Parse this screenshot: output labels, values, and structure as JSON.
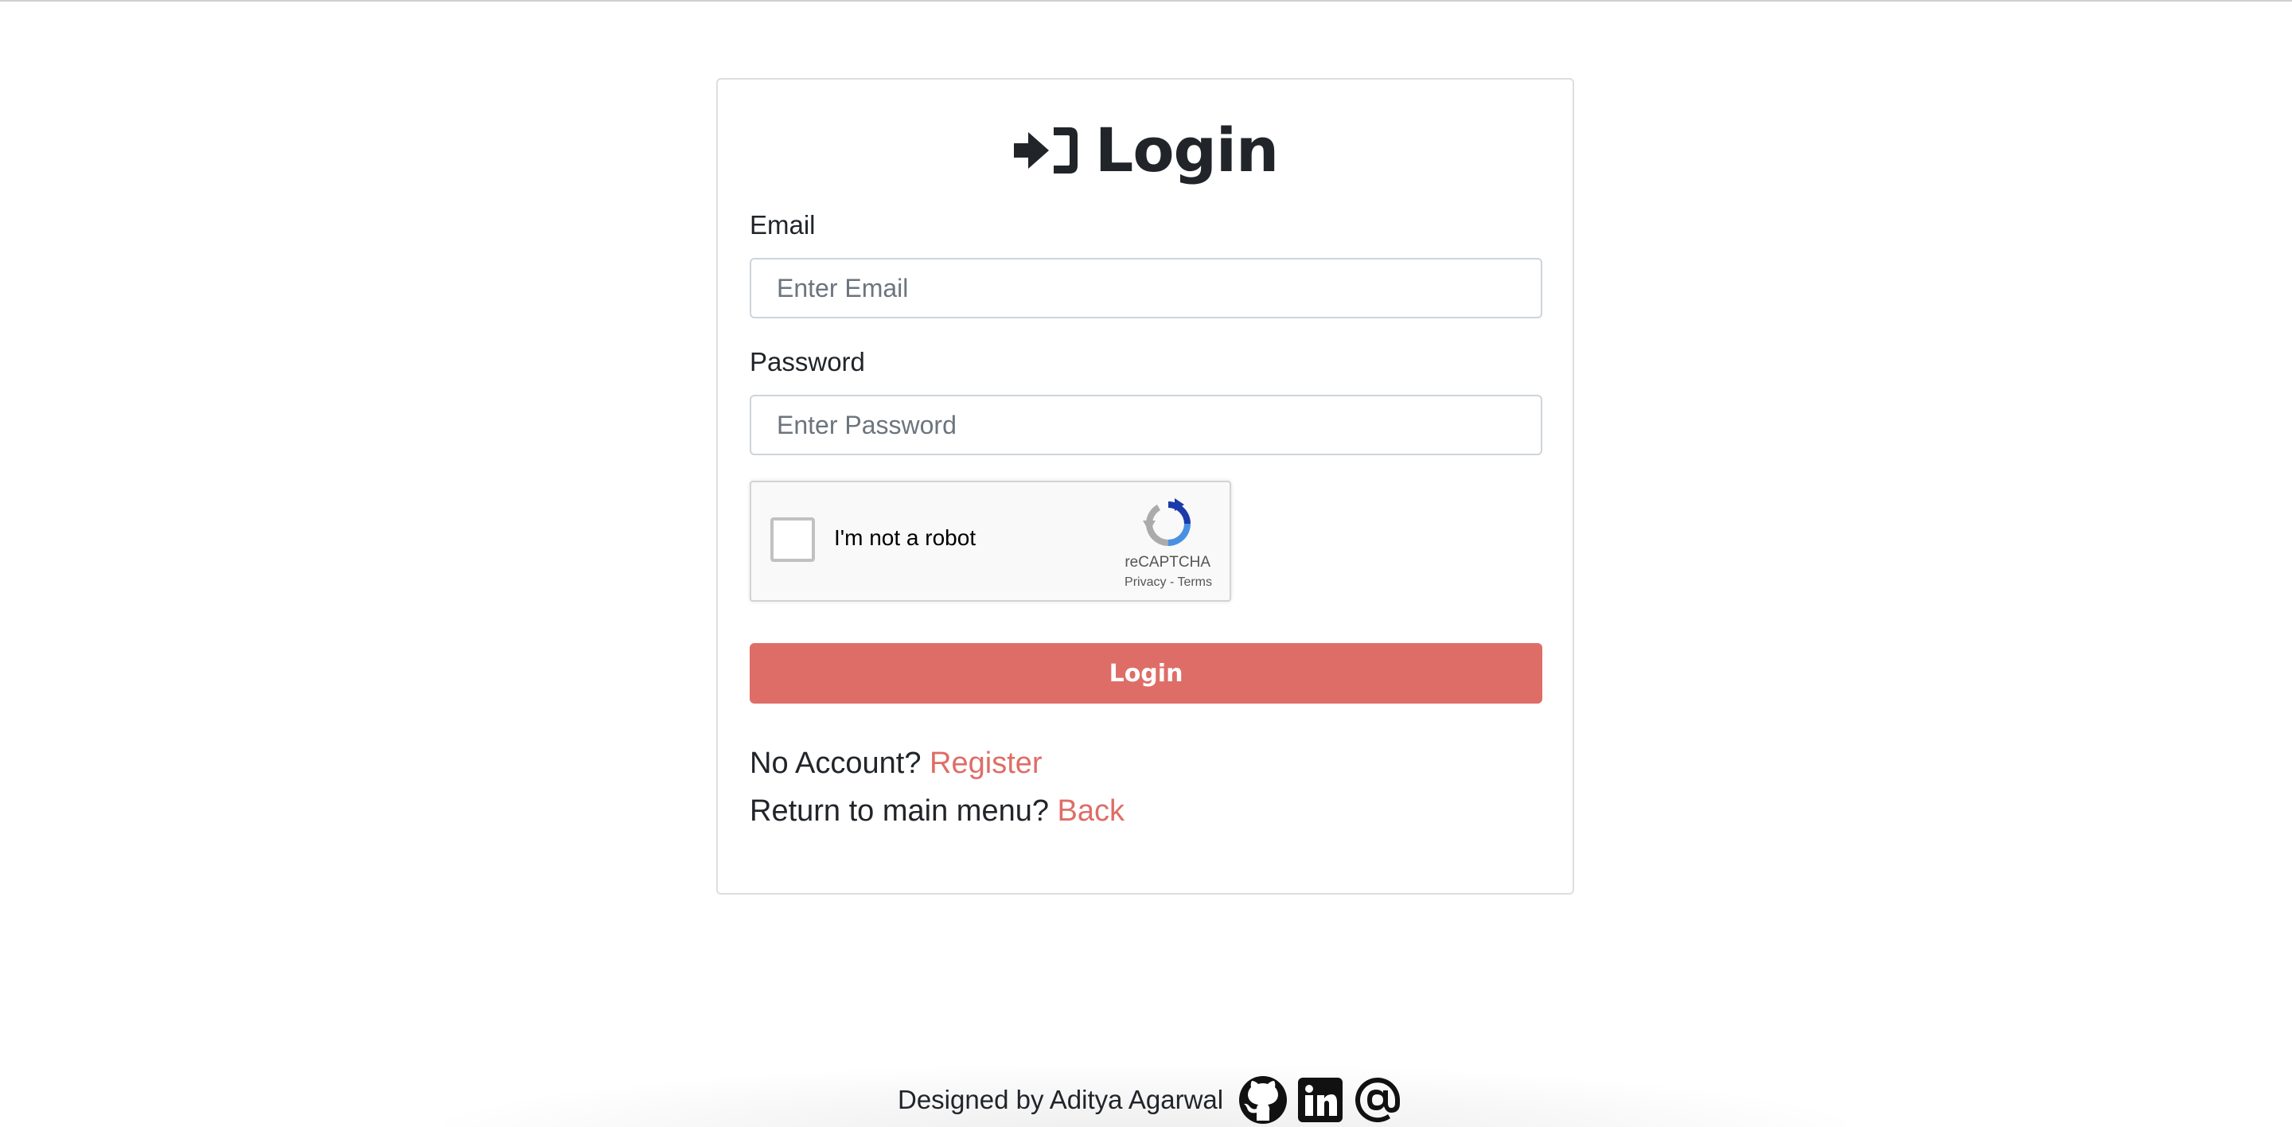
{
  "page": {
    "title": "Login",
    "title_icon": "sign-in-icon"
  },
  "form": {
    "email_label": "Email",
    "email_placeholder": "Enter Email",
    "email_value": "",
    "password_label": "Password",
    "password_placeholder": "Enter Password",
    "password_value": "",
    "submit_label": "Login"
  },
  "captcha": {
    "label": "I'm not a robot",
    "brand": "reCAPTCHA",
    "privacy": "Privacy",
    "separator": " - ",
    "terms": "Terms",
    "checked": false,
    "icon": "recaptcha-logo-icon"
  },
  "links": {
    "register_prompt": "No Account? ",
    "register_link": "Register",
    "back_prompt": "Return to main menu? ",
    "back_link": "Back"
  },
  "footer": {
    "credit": "Designed by Aditya Agarwal",
    "icons": [
      "github-icon",
      "linkedin-icon",
      "email-at-icon"
    ]
  },
  "colors": {
    "accent": "#df6d67",
    "text": "#212529",
    "border": "#dedede",
    "input_border": "#ced4da"
  }
}
